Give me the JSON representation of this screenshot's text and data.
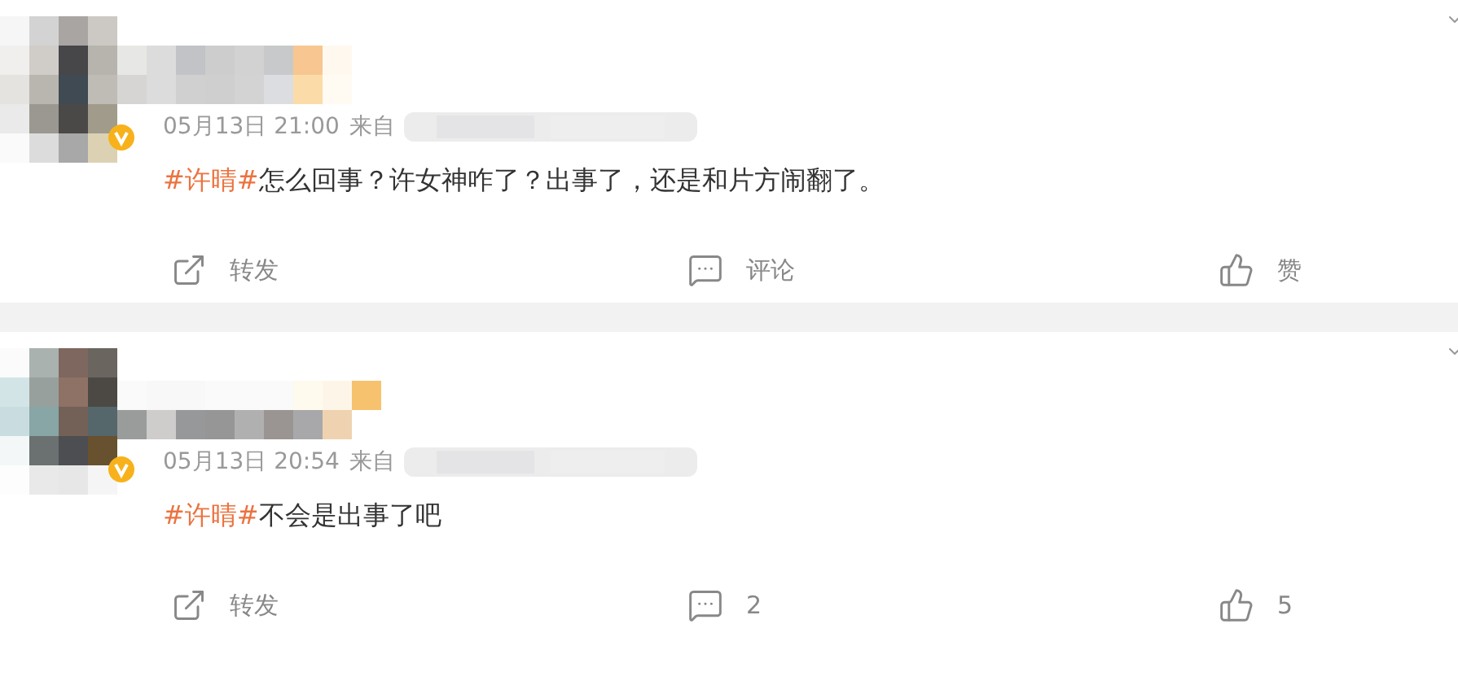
{
  "posts": [
    {
      "time": "05月13日 21:00",
      "source_label": "来自",
      "hashtag": "#许晴#",
      "text": "怎么回事？许女神咋了？出事了，还是和片方闹翻了。",
      "verified": true,
      "actions": [
        {
          "kind": "repost",
          "label": "转发"
        },
        {
          "kind": "comment",
          "label": "评论"
        },
        {
          "kind": "like",
          "label": "赞"
        }
      ]
    },
    {
      "time": "05月13日 20:54",
      "source_label": "来自",
      "hashtag": "#许晴#",
      "text": "不会是出事了吧",
      "verified": true,
      "actions": [
        {
          "kind": "repost",
          "label": "转发"
        },
        {
          "kind": "comment",
          "label": "2"
        },
        {
          "kind": "like",
          "label": "5"
        }
      ]
    }
  ]
}
